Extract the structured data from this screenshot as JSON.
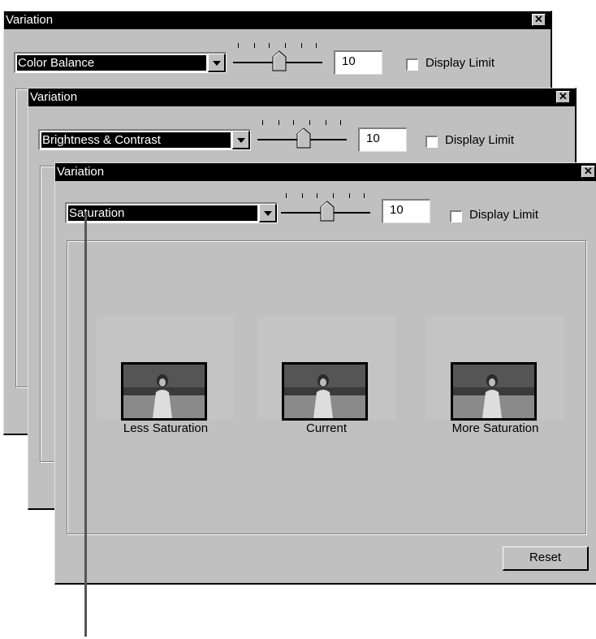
{
  "windows": [
    {
      "title": "Variation",
      "mode": "Color Balance",
      "value": "10",
      "display_limit_label": "Display Limit",
      "display_limit_checked": false
    },
    {
      "title": "Variation",
      "mode": "Brightness & Contrast",
      "value": "10",
      "display_limit_label": "Display Limit",
      "display_limit_checked": false
    },
    {
      "title": "Variation",
      "mode": "Saturation",
      "value": "10",
      "display_limit_label": "Display Limit",
      "display_limit_checked": false,
      "variations": [
        {
          "label": "Less Saturation"
        },
        {
          "label": "Current"
        },
        {
          "label": "More Saturation"
        }
      ],
      "reset_label": "Reset"
    }
  ],
  "close_glyph": "✕"
}
